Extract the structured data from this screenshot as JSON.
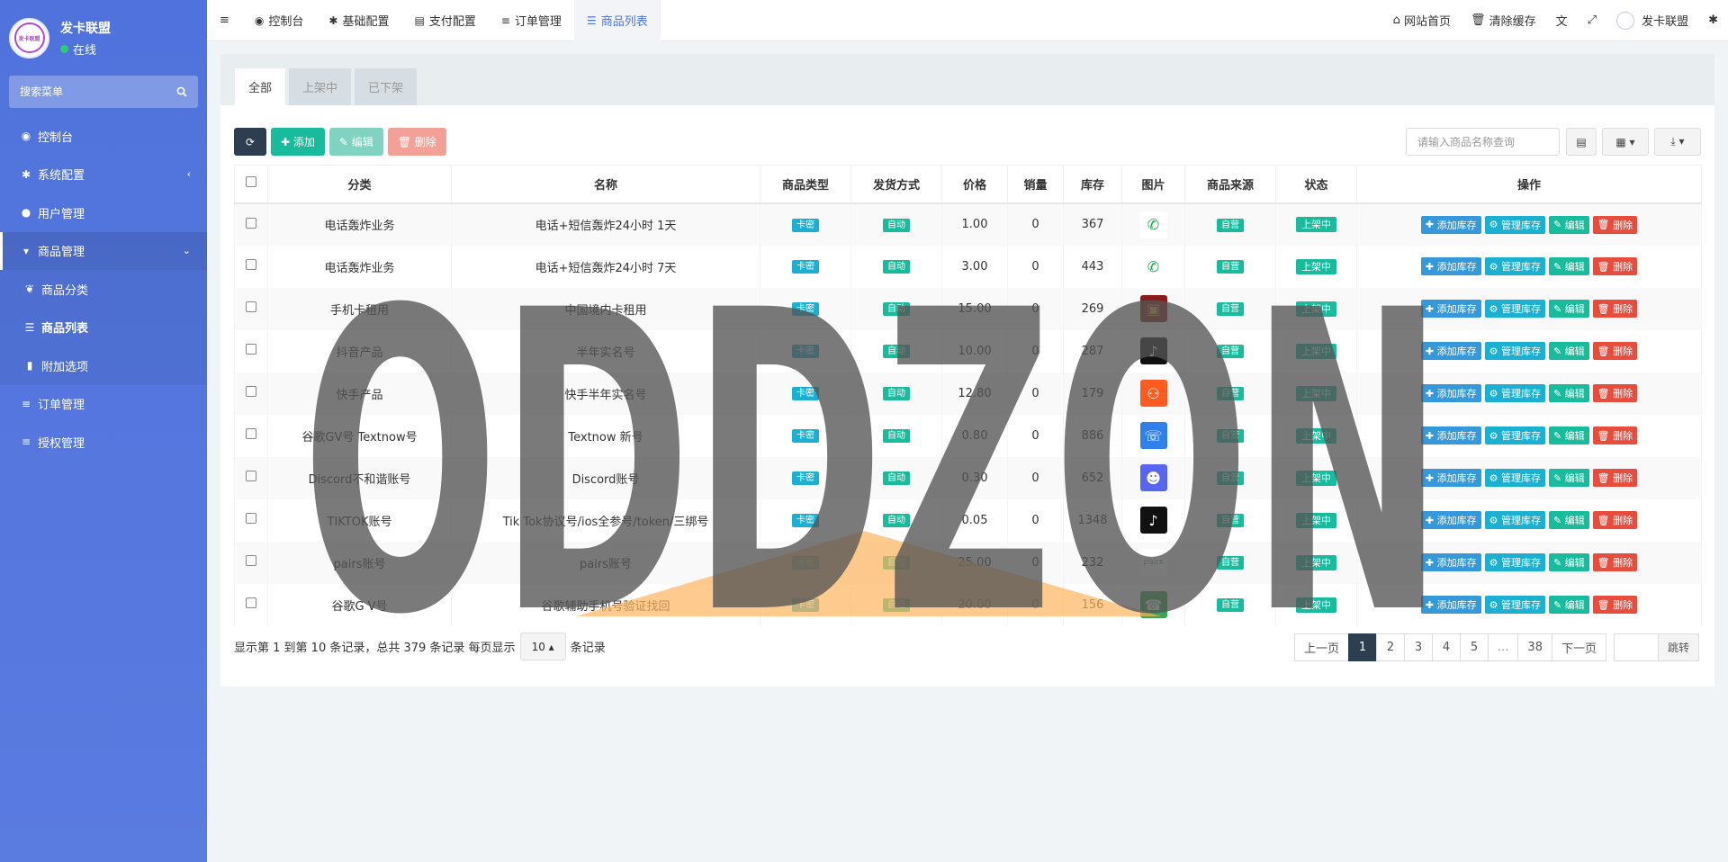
{
  "app": {
    "user_name": "发卡联盟",
    "user_status": "在线",
    "avatar_text": "发卡联盟"
  },
  "sidebar": {
    "search_placeholder": "搜索菜单",
    "items": [
      {
        "label": "控制台",
        "icon": "dashboard-icon"
      },
      {
        "label": "系统配置",
        "icon": "gear-icon"
      },
      {
        "label": "用户管理",
        "icon": "user-icon"
      },
      {
        "label": "商品管理",
        "icon": "cart-icon"
      },
      {
        "label": "商品分类",
        "icon": "leaf-icon"
      },
      {
        "label": "商品列表",
        "icon": "list-icon"
      },
      {
        "label": "附加选项",
        "icon": "bookmark-icon"
      },
      {
        "label": "订单管理",
        "icon": "bars-icon"
      },
      {
        "label": "授权管理",
        "icon": "bars-icon"
      }
    ]
  },
  "topnav": {
    "tabs": [
      "控制台",
      "基础配置",
      "支付配置",
      "订单管理",
      "商品列表"
    ],
    "right": [
      "网站首页",
      "清除缓存",
      "发卡联盟"
    ]
  },
  "panel": {
    "tabs": [
      "全部",
      "上架中",
      "已下架"
    ],
    "buttons": {
      "add": "添加",
      "edit": "编辑",
      "delete": "删除"
    },
    "search_placeholder": "请输入商品名称查询"
  },
  "table": {
    "headers": [
      "分类",
      "名称",
      "商品类型",
      "发货方式",
      "价格",
      "销量",
      "库存",
      "图片",
      "商品来源",
      "状态",
      "操作"
    ],
    "type_label": "卡密",
    "ship_label": "自动",
    "source_label": "自营",
    "status_label": "上架中",
    "ops": [
      "添加库存",
      "管理库存",
      "编辑",
      "删除"
    ],
    "rows": [
      {
        "category": "电话轰炸业务",
        "name": "电话+短信轰炸24小时 1天",
        "price": "1.00",
        "sales": "0",
        "stock": "367",
        "img": "phone-icon",
        "img_color": "#ffffff"
      },
      {
        "category": "电话轰炸业务",
        "name": "电话+短信轰炸24小时 7天",
        "price": "3.00",
        "sales": "0",
        "stock": "443",
        "img": "phone-icon",
        "img_color": "#ffffff"
      },
      {
        "category": "手机卡租用",
        "name": "中国境内卡租用",
        "price": "15.00",
        "sales": "0",
        "stock": "269",
        "img": "sim-card-icon",
        "img_color": "#8b1a1a"
      },
      {
        "category": "抖音产品",
        "name": "半年实名号",
        "price": "10.00",
        "sales": "0",
        "stock": "287",
        "img": "tiktok-icon",
        "img_color": "#111111"
      },
      {
        "category": "快手产品",
        "name": "快手半年实名号",
        "price": "12.80",
        "sales": "0",
        "stock": "179",
        "img": "kuaishou-icon",
        "img_color": "#ff5a1f"
      },
      {
        "category": "谷歌GV号 Textnow号",
        "name": "Textnow 新号",
        "price": "0.80",
        "sales": "0",
        "stock": "886",
        "img": "textnow-icon",
        "img_color": "#2f80ed"
      },
      {
        "category": "Discord不和谐账号",
        "name": "Discord账号",
        "price": "0.30",
        "sales": "0",
        "stock": "652",
        "img": "discord-icon",
        "img_color": "#5865f2"
      },
      {
        "category": "TIKTOK账号",
        "name": "Tik Tok协议号/ios全参号/token/三绑号",
        "price": "0.05",
        "sales": "0",
        "stock": "1348",
        "img": "tiktok-icon",
        "img_color": "#111111"
      },
      {
        "category": "pairs账号",
        "name": "pairs账号",
        "price": "25.00",
        "sales": "0",
        "stock": "232",
        "img": "pairs-icon",
        "img_color": "#ffffff"
      },
      {
        "category": "谷歌G V号",
        "name": "谷歌辅助手机号验证找回",
        "price": "20.00",
        "sales": "0",
        "stock": "156",
        "img": "google-voice-icon",
        "img_color": "#34a853"
      }
    ]
  },
  "pager": {
    "info_prefix": "显示第 1 到第 10 条记录，总共 379 条记录 每页显示",
    "page_size": "10",
    "info_suffix": "条记录",
    "prev": "上一页",
    "pages": [
      "1",
      "2",
      "3",
      "4",
      "5",
      "...",
      "38"
    ],
    "next": "下一页",
    "jump": "跳转"
  },
  "watermark": {
    "text": "ODDZON"
  }
}
